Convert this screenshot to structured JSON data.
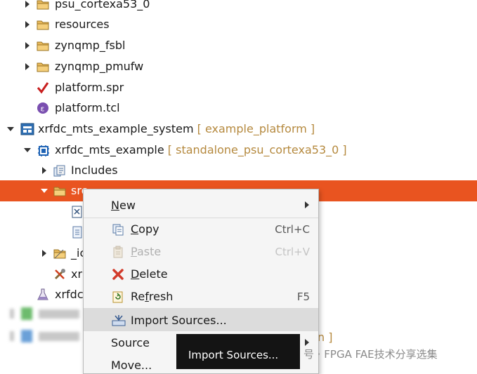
{
  "tree": {
    "items": [
      {
        "label": "psu_cortexa53_0",
        "icon": "folder-icon"
      },
      {
        "label": "resources",
        "icon": "folder-icon"
      },
      {
        "label": "zynqmp_fsbl",
        "icon": "folder-icon"
      },
      {
        "label": "zynqmp_pmufw",
        "icon": "folder-icon"
      },
      {
        "label": "platform.spr",
        "icon": "spr-file-icon"
      },
      {
        "label": "platform.tcl",
        "icon": "tcl-file-icon"
      },
      {
        "label": "xrfdc_mts_example_system",
        "decoration": "[ example_platform ]",
        "icon": "system-project-icon"
      },
      {
        "label": "xrfdc_mts_example",
        "decoration": "[ standalone_psu_cortexa53_0 ]",
        "icon": "application-project-icon"
      },
      {
        "label": "Includes",
        "icon": "includes-icon"
      },
      {
        "label": "src",
        "icon": "folder-icon"
      },
      {
        "label": "_ic",
        "icon": "folder-icon"
      },
      {
        "label": "xr",
        "icon": "build-config-icon"
      },
      {
        "label": "xrfdc",
        "icon": "flask-icon"
      }
    ],
    "partial_decoration": "n ]"
  },
  "context_menu": {
    "items": [
      {
        "label": "New",
        "mnemonic": "N",
        "submenu": true
      },
      {
        "label": "Copy",
        "mnemonic": "C",
        "shortcut": "Ctrl+C",
        "icon": "copy-icon"
      },
      {
        "label": "Paste",
        "mnemonic": "P",
        "shortcut": "Ctrl+V",
        "icon": "paste-icon",
        "disabled": true
      },
      {
        "label": "Delete",
        "mnemonic": "D",
        "icon": "delete-icon"
      },
      {
        "label": "Refresh",
        "mnemonic": "f",
        "shortcut": "F5",
        "icon": "refresh-icon"
      },
      {
        "label": "Import Sources...",
        "icon": "import-icon",
        "highlighted": true
      },
      {
        "label": "Source",
        "submenu": true
      },
      {
        "label": "Move..."
      }
    ]
  },
  "tooltip": {
    "text": "Import Sources..."
  },
  "watermark": {
    "text": "号 · FPGA FAE技术分享选集"
  },
  "colors": {
    "selection": "#e95420",
    "decoration": "#b5893e",
    "tooltip_bg": "#141414"
  }
}
